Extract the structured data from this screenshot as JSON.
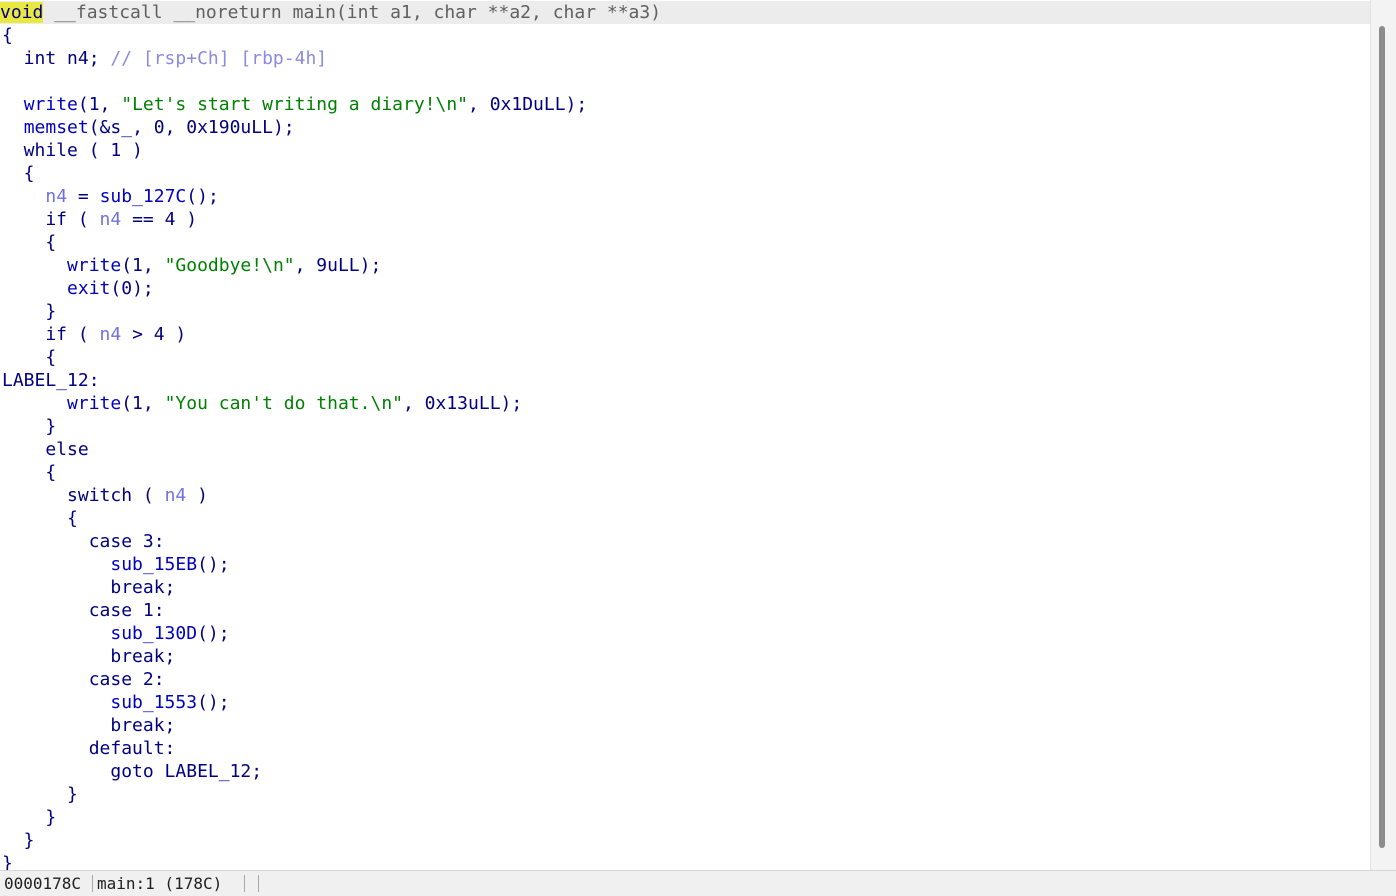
{
  "code": {
    "header": {
      "type": "void",
      "rest": " __fastcall __noreturn main(int a1, char **a2, char **a3)"
    },
    "open_brace": "{",
    "l2_decl": "  int n4; ",
    "l2_comment": "// [rsp+Ch] [rbp-4h]",
    "l4_fn": "write",
    "l4_pre": "(1, ",
    "l4_str": "\"Let's start writing a diary!\\n\"",
    "l4_post": ", 0x1DuLL);",
    "l5_fn": "memset",
    "l5_args": "(&s_, 0, 0x190uLL);",
    "l6": "  while ( 1 )",
    "l7": "  {",
    "l8_var": "n4",
    "l8_mid": " = ",
    "l8_fn": "sub_127C",
    "l8_end": "();",
    "l9_pre": "    if ( ",
    "l9_var": "n4",
    "l9_post": " == 4 )",
    "l10": "    {",
    "l11_fn": "write",
    "l11_pre": "(1, ",
    "l11_str": "\"Goodbye!\\n\"",
    "l11_post": ", 9uLL);",
    "l12_fn": "exit",
    "l12_args": "(0);",
    "l13": "    }",
    "l14_pre": "    if ( ",
    "l14_var": "n4",
    "l14_post": " > 4 )",
    "l15": "    {",
    "l16": "LABEL_12:",
    "l17_fn": "write",
    "l17_pre": "(1, ",
    "l17_str": "\"You can't do that.\\n\"",
    "l17_post": ", 0x13uLL);",
    "l18": "    }",
    "l19": "    else",
    "l20": "    {",
    "l21_pre": "      switch ( ",
    "l21_var": "n4",
    "l21_post": " )",
    "l22": "      {",
    "l23": "        case 3:",
    "l24_fn": "sub_15EB",
    "l24_end": "();",
    "l25": "          break;",
    "l26": "        case 1:",
    "l27_fn": "sub_130D",
    "l27_end": "();",
    "l28": "          break;",
    "l29": "        case 2:",
    "l30_fn": "sub_1553",
    "l30_end": "();",
    "l31": "          break;",
    "l32": "        default:",
    "l33": "          goto LABEL_12;",
    "l34": "      }",
    "l35": "    }",
    "l36": "  }",
    "l37": "}"
  },
  "status_bar": {
    "address": "0000178C",
    "location": "main:1 (178C)"
  },
  "colors": {
    "keyword_highlight": "#e8e840",
    "string": "#008000",
    "function": "#0000c0",
    "variable": "#7070e0",
    "comment": "#8a8ae0",
    "default_text": "#000080"
  }
}
